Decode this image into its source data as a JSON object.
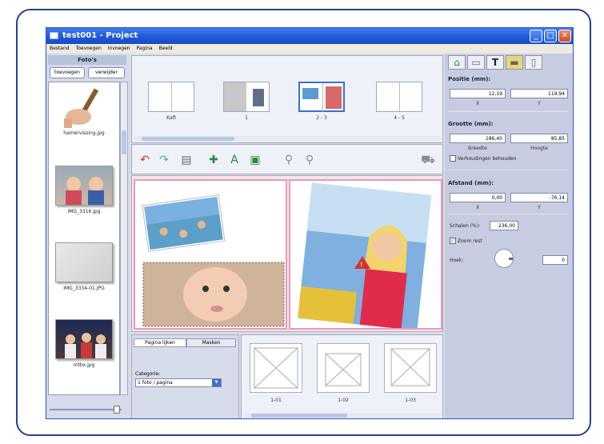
{
  "window": {
    "title": "test001 - Project"
  },
  "menu": [
    "Bestand",
    "Toevoegen",
    "Invoegen",
    "Pagina",
    "Beeld"
  ],
  "left": {
    "header": "Foto's",
    "add_label": "toevoegen",
    "remove_label": "verwijder",
    "photos": [
      "hamervissing.jpg",
      "IMG_3316.jpg",
      "IMG_3334-01.JPG",
      "mtbx.jpg"
    ]
  },
  "pages": [
    {
      "label": "Kaft"
    },
    {
      "label": "1"
    },
    {
      "label": "2 - 3"
    },
    {
      "label": "4 - 5"
    }
  ],
  "bottom": {
    "tab_pages": "Pagina lijken",
    "tab_masks": "Masken",
    "category_label": "Categorie:",
    "category_value": "1 foto / pagina",
    "layouts": [
      "1-01",
      "1-02",
      "1-03"
    ]
  },
  "props": {
    "position_label": "Positie (mm):",
    "pos_x": "12,19",
    "pos_y": "119,94",
    "x_label": "X",
    "y_label": "Y",
    "size_label": "Grootte (mm):",
    "width": "186,40",
    "height": "85,85",
    "width_label": "Breedte",
    "height_label": "Hoogte",
    "keep_ratio": "Verhoudingen behouden",
    "distance_label": "Afstand (mm):",
    "dist_x": "0,00",
    "dist_y": "-76,14",
    "scale_label": "Schalen (%):",
    "scale_value": "236,00",
    "zoom_label": "Zoom rest",
    "rotate_label": "Hoek:",
    "rotate_value": "0"
  }
}
